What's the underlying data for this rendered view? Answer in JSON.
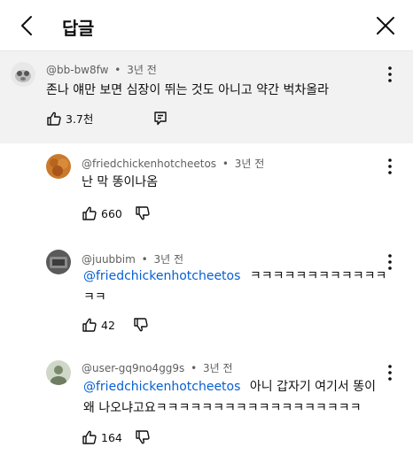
{
  "header": {
    "title": "답글"
  },
  "parent_comment": {
    "author": "@bb-bw8fw",
    "time": "3년 전",
    "text": "존나 얘만 보면 심장이 뛰는 것도 아니고 약간 벅차올라",
    "likes": "3.7천"
  },
  "replies": [
    {
      "author": "@friedchickenhotcheetos",
      "time": "3년 전",
      "text_line1": "난 막 똥이나옴",
      "likes": "660"
    },
    {
      "author": "@juubbim",
      "time": "3년 전",
      "mention": "@friedchickenhotcheetos",
      "text_line1": "ㅋㅋㅋㅋㅋㅋㅋㅋㅋㅋㅋㅋ",
      "text_line2": "ㅋㅋ",
      "likes": "42"
    },
    {
      "author": "@user-gq9no4gg9s",
      "time": "3년 전",
      "mention": "@friedchickenhotcheetos",
      "text_line1": "아니 갑자기 여기서 똥이",
      "text_line2": "왜 나오냐고요ㅋㅋㅋㅋㅋㅋㅋㅋㅋㅋㅋㅋㅋㅋㅋㅋㅋㅋ",
      "likes": "164"
    }
  ],
  "meta_separator": "•",
  "icons": {
    "back": "chevron-left-icon",
    "close": "close-icon",
    "like": "thumbs-up-icon",
    "dislike": "thumbs-down-icon",
    "reply": "comment-reply-icon",
    "more": "more-vertical-icon"
  },
  "colors": {
    "mention": "#065fd4",
    "meta": "#606060",
    "parent_bg": "#f2f2f2"
  }
}
